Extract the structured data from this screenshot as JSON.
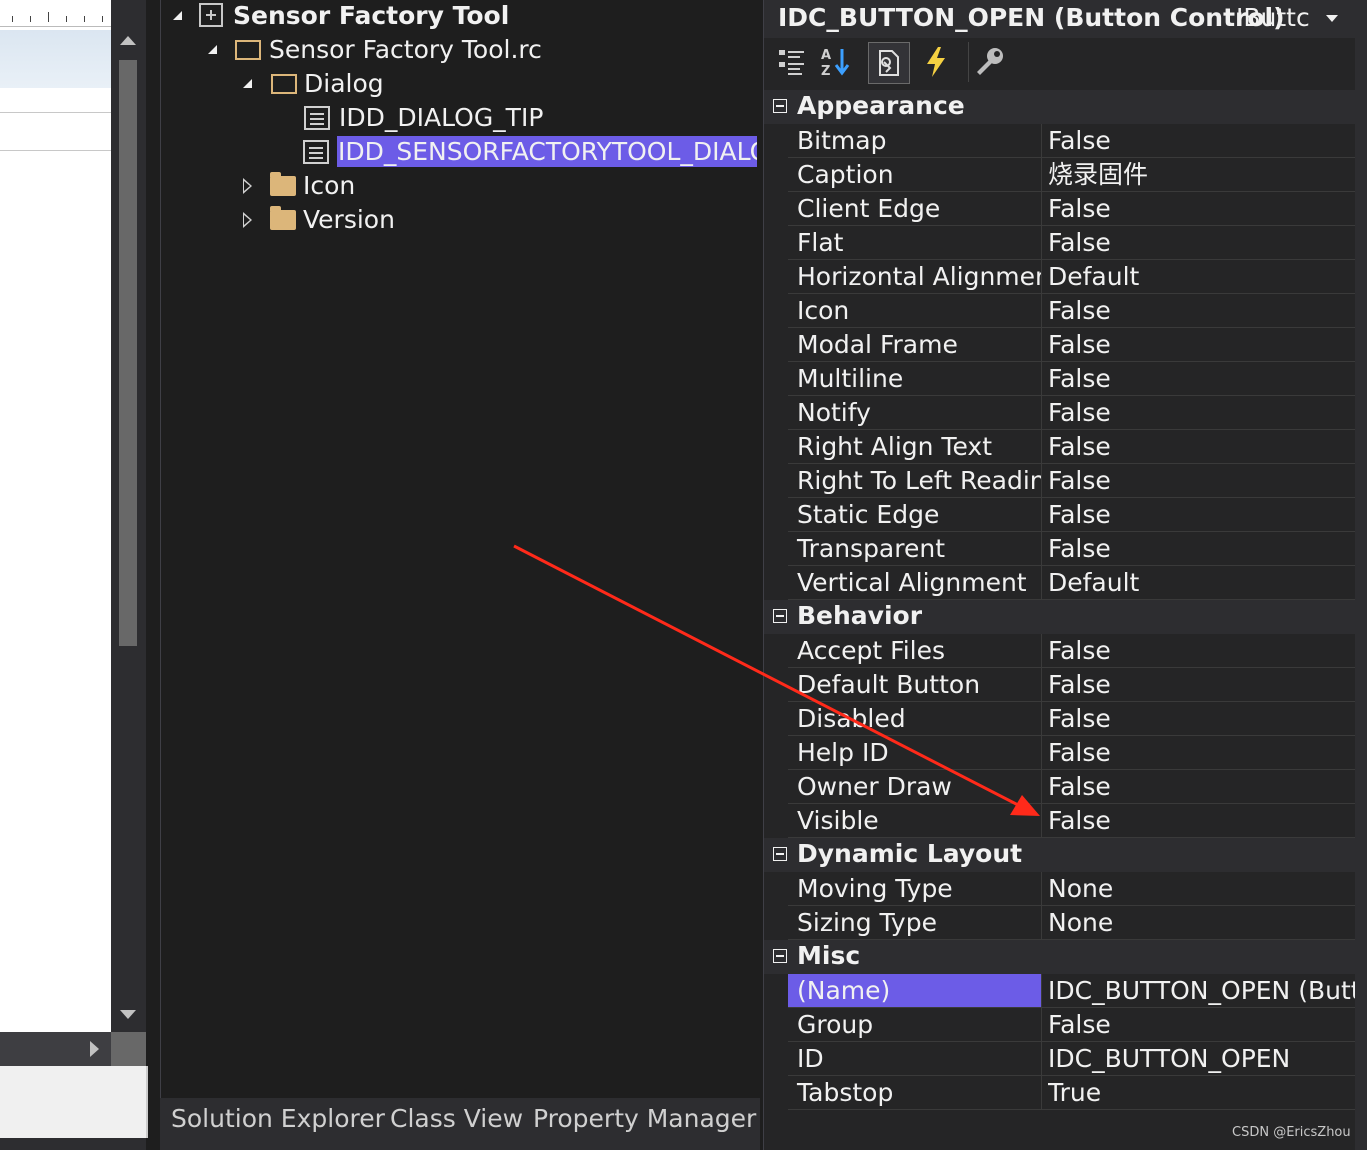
{
  "solution_explorer": {
    "project": "Sensor Factory Tool",
    "rc_file": "Sensor Factory Tool.rc",
    "dialog_folder": "Dialog",
    "dialog_tip": "IDD_DIALOG_TIP",
    "dialog_main": "IDD_SENSORFACTORYTOOL_DIALOG",
    "icon_folder": "Icon",
    "version_folder": "Version"
  },
  "tabs": [
    "Solution Explorer",
    "Class View",
    "Property Manager"
  ],
  "properties": {
    "title": "IDC_BUTTON_OPEN (Button Control)",
    "class_name": "IButtc",
    "categories": [
      {
        "name": "Appearance",
        "rows": [
          {
            "name": "Bitmap",
            "value": "False"
          },
          {
            "name": "Caption",
            "value": "烧录固件"
          },
          {
            "name": "Client Edge",
            "value": "False"
          },
          {
            "name": "Flat",
            "value": "False"
          },
          {
            "name": "Horizontal Alignment",
            "value": "Default"
          },
          {
            "name": "Icon",
            "value": "False"
          },
          {
            "name": "Modal Frame",
            "value": "False"
          },
          {
            "name": "Multiline",
            "value": "False"
          },
          {
            "name": "Notify",
            "value": "False"
          },
          {
            "name": "Right Align Text",
            "value": "False"
          },
          {
            "name": "Right To Left Reading",
            "value": "False"
          },
          {
            "name": "Static Edge",
            "value": "False"
          },
          {
            "name": "Transparent",
            "value": "False"
          },
          {
            "name": "Vertical Alignment",
            "value": "Default"
          }
        ]
      },
      {
        "name": "Behavior",
        "rows": [
          {
            "name": "Accept Files",
            "value": "False"
          },
          {
            "name": "Default Button",
            "value": "False"
          },
          {
            "name": "Disabled",
            "value": "False"
          },
          {
            "name": "Help ID",
            "value": "False"
          },
          {
            "name": "Owner Draw",
            "value": "False"
          },
          {
            "name": "Visible",
            "value": "False"
          }
        ]
      },
      {
        "name": "Dynamic Layout",
        "rows": [
          {
            "name": "Moving Type",
            "value": "None"
          },
          {
            "name": "Sizing Type",
            "value": "None"
          }
        ]
      },
      {
        "name": "Misc",
        "rows": [
          {
            "name": "(Name)",
            "value": "IDC_BUTTON_OPEN (Butto",
            "selected": true
          },
          {
            "name": "Group",
            "value": "False"
          },
          {
            "name": "ID",
            "value": "IDC_BUTTON_OPEN"
          },
          {
            "name": "Tabstop",
            "value": "True"
          }
        ]
      }
    ]
  },
  "watermark": "CSDN @EricsZhou",
  "colors": {
    "selection": "#6c5ce7",
    "annotation_arrow": "#ff2a1a",
    "folder": "#dcb67a"
  }
}
